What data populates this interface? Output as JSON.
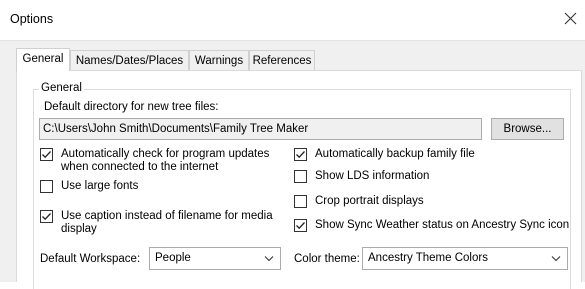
{
  "window": {
    "title": "Options"
  },
  "tabs": [
    {
      "label": "General",
      "active": true
    },
    {
      "label": "Names/Dates/Places",
      "active": false
    },
    {
      "label": "Warnings",
      "active": false
    },
    {
      "label": "References",
      "active": false
    }
  ],
  "general": {
    "group_label": "General",
    "default_dir_label": "Default directory for new tree files:",
    "default_dir_value": "C:\\Users\\John Smith\\Documents\\Family Tree Maker",
    "browse_label": "Browse...",
    "options_left": [
      {
        "line1": "Automatically check for program updates",
        "line2": "when connected to the internet",
        "checked": true
      },
      {
        "line1": "Use large fonts",
        "line2": "",
        "checked": false
      },
      {
        "line1": "Use caption instead of filename for media",
        "line2": "display",
        "checked": true
      }
    ],
    "options_right": [
      {
        "label": "Automatically backup family file",
        "checked": true
      },
      {
        "label": "Show LDS information",
        "checked": false
      },
      {
        "label": "Crop portrait displays",
        "checked": false
      },
      {
        "label": "Show Sync Weather status on Ancestry Sync icon",
        "checked": true
      }
    ],
    "workspace": {
      "label": "Default Workspace:",
      "value": "People"
    },
    "color_theme": {
      "label": "Color theme:",
      "value": "Ancestry Theme Colors"
    }
  },
  "icons": {
    "close": "close-icon",
    "check": "checkmark-icon",
    "dropdown": "chevron-down-icon"
  }
}
